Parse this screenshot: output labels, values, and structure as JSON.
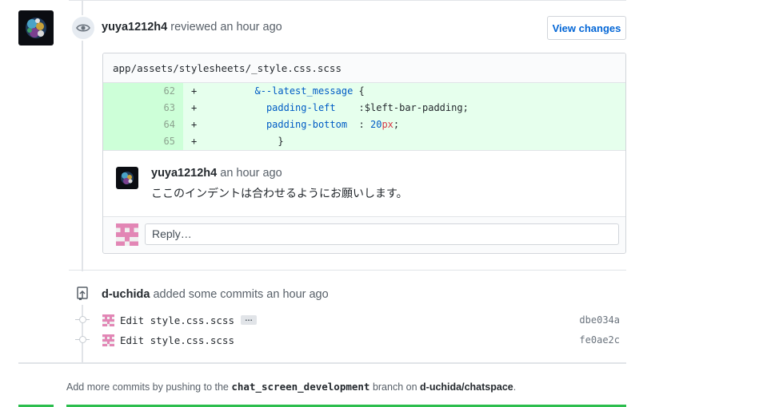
{
  "review": {
    "author": "yuya1212h4",
    "action": "reviewed an hour ago",
    "view_changes_label": "View changes"
  },
  "diff": {
    "file_path": "app/assets/stylesheets/_style.css.scss",
    "lines": [
      {
        "num": "62",
        "sign": "+",
        "indent": "          ",
        "parts": [
          {
            "t": "&--latest_message",
            "c": "kw"
          },
          {
            "t": " {",
            "c": ""
          }
        ]
      },
      {
        "num": "63",
        "sign": "+",
        "indent": "            ",
        "parts": [
          {
            "t": "padding-left",
            "c": "kw"
          },
          {
            "t": "    :$left-bar-padding;",
            "c": ""
          }
        ]
      },
      {
        "num": "64",
        "sign": "+",
        "indent": "            ",
        "parts": [
          {
            "t": "padding-bottom",
            "c": "kw"
          },
          {
            "t": "  : ",
            "c": ""
          },
          {
            "t": "20",
            "c": "kw"
          },
          {
            "t": "px",
            "c": "num"
          },
          {
            "t": ";",
            "c": ""
          }
        ]
      },
      {
        "num": "65",
        "sign": "+",
        "indent": "              ",
        "parts": [
          {
            "t": "}",
            "c": ""
          }
        ]
      }
    ]
  },
  "comment": {
    "author": "yuya1212h4",
    "time": "an hour ago",
    "body": "ここのインデントは合わせるようにお願いします。",
    "reply_placeholder": "Reply…"
  },
  "commits_event": {
    "author": "d-uchida",
    "action": "added some commits an hour ago",
    "commits": [
      {
        "message": "Edit style.css.scss",
        "sha": "dbe034a",
        "has_ellipsis": true,
        "ellipsis": "…"
      },
      {
        "message": "Edit style.css.scss",
        "sha": "fe0ae2c",
        "has_ellipsis": false
      }
    ]
  },
  "footer": {
    "prefix": "Add more commits by pushing to the",
    "branch": "chat_screen_development",
    "middle": "branch on",
    "repo": "d-uchida/chatspace",
    "suffix": "."
  },
  "colors": {
    "addition_bg": "#e6ffed",
    "addition_ln_bg": "#cdffd8",
    "link": "#0366d6",
    "identicon": "#e286b5"
  }
}
